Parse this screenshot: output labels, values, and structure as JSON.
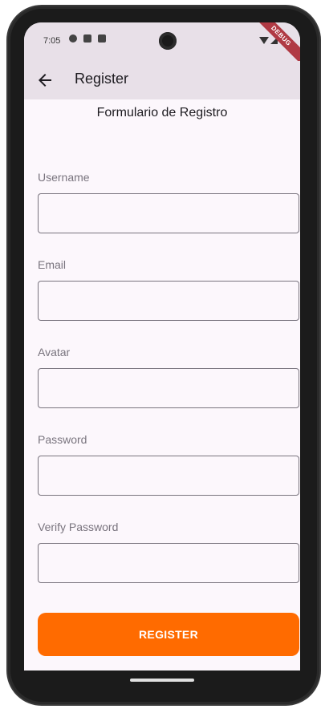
{
  "status_bar": {
    "time": "7:05"
  },
  "debug_banner": "DEBUG",
  "app_bar": {
    "title": "Register"
  },
  "form": {
    "heading": "Formulario de Registro",
    "fields": [
      {
        "label": "Username",
        "value": ""
      },
      {
        "label": "Email",
        "value": ""
      },
      {
        "label": "Avatar",
        "value": ""
      },
      {
        "label": "Password",
        "value": ""
      },
      {
        "label": "Verify Password",
        "value": ""
      }
    ],
    "submit_label": "REGISTER"
  },
  "colors": {
    "accent": "#ff6b00",
    "app_bar": "#e8e0e8",
    "background": "#fcf7fc"
  }
}
